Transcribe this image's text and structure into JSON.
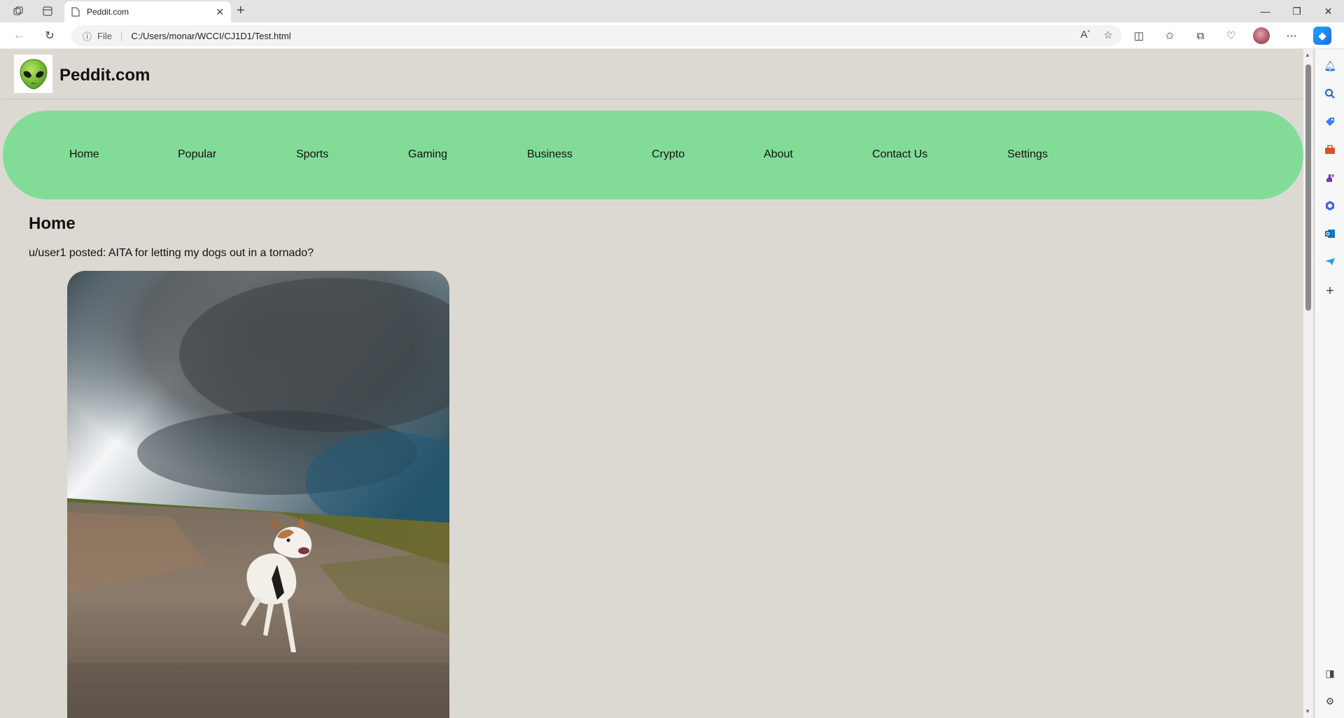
{
  "browser": {
    "tab_title": "Peddit.com",
    "address_scheme_label": "File",
    "address_url": "C:/Users/monar/WCCI/CJ1D1/Test.html"
  },
  "site": {
    "title": "Peddit.com",
    "logo_icon": "alien-face-icon"
  },
  "menu": {
    "items": [
      "Home",
      "Popular",
      "Sports",
      "Gaming",
      "Business",
      "Crypto",
      "About",
      "Contact Us",
      "Settings"
    ]
  },
  "main": {
    "heading": "Home",
    "post": {
      "line": "u/user1 posted: AITA for letting my dogs out in a tornado?",
      "image_subject": "dog-running-under-storm-clouds"
    }
  },
  "colors": {
    "page_bg": "#dcd9d3",
    "menu_bg": "#82dc98"
  }
}
